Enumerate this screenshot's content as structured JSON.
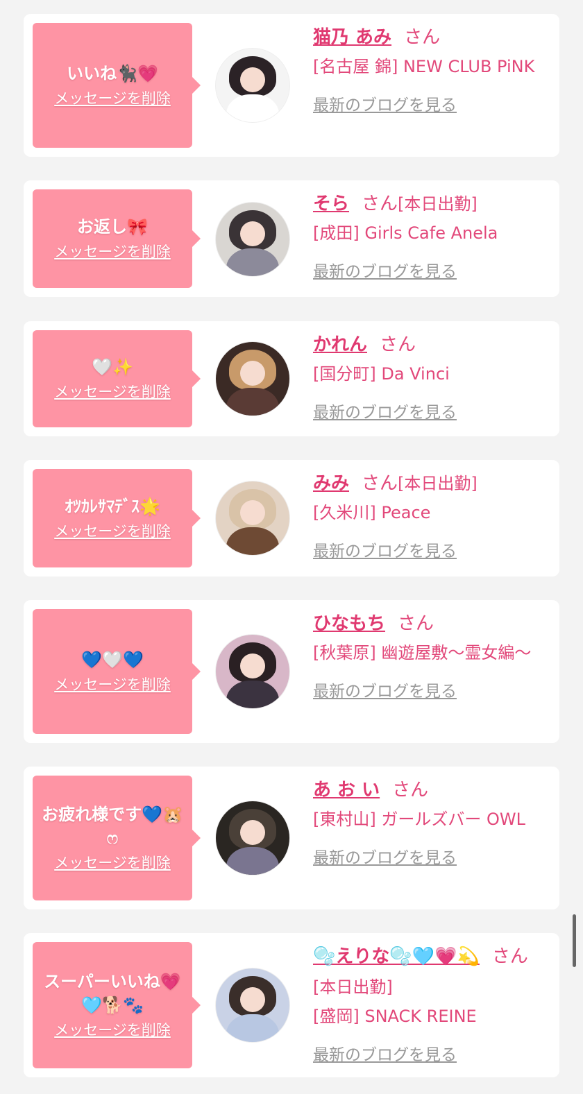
{
  "delete_label": "メッセージを削除",
  "blog_label": "最新のブログを見る",
  "san_label": "さん",
  "colors": {
    "accent_pink": "#fe94a4",
    "name_pink": "#e03970",
    "text_pink": "#e2487a",
    "link_gray": "#999999",
    "page_bg": "#f3f3f3"
  },
  "messages": [
    {
      "message": "いいね🐈‍⬛💗",
      "name": "猫乃 あみ",
      "badge": "",
      "shop": "[名古屋 錦] NEW CLUB PiNK",
      "avatar_icon": "avatar-photo-icon"
    },
    {
      "message": "お返し🎀",
      "name": "そら",
      "badge": "[本日出勤]",
      "shop": "[成田] Girls Cafe Anela",
      "avatar_icon": "avatar-photo-icon"
    },
    {
      "message": "🤍✨",
      "name": "かれん",
      "badge": "",
      "shop": "[国分町] Da Vinci",
      "avatar_icon": "avatar-photo-icon"
    },
    {
      "message": "ｵﾂｶﾚｻﾏﾃﾞｽ🌟",
      "name": "みみ",
      "badge": "[本日出勤]",
      "shop": "[久米川] Peace",
      "avatar_icon": "avatar-photo-icon"
    },
    {
      "message": "💙🤍💙",
      "name": "ひなもち",
      "badge": "",
      "shop": "[秋葉原] 幽遊屋敷〜霊女編〜",
      "avatar_icon": "avatar-photo-icon"
    },
    {
      "message": "お疲れ様です💙🐹ෆ",
      "name": "あ お い",
      "badge": "",
      "shop": "[東村山] ガールズバー OWL",
      "avatar_icon": "avatar-photo-icon"
    },
    {
      "message": "スーパーいいね💗🩵🐕🐾",
      "name": "🫧えりな🫧🩵💗💫",
      "badge": "[本日出勤]",
      "shop": "[盛岡] SNACK REINE",
      "avatar_icon": "avatar-photo-icon"
    }
  ]
}
